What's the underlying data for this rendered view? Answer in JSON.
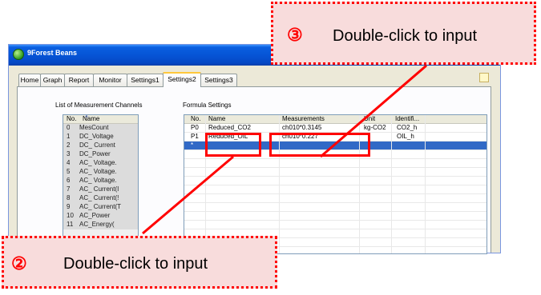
{
  "window": {
    "title": "9Forest Beans"
  },
  "tabs": [
    "Home",
    "Graph",
    "Report",
    "Monitor",
    "Settings1",
    "Settings2",
    "Settings3"
  ],
  "active_tab": "Settings2",
  "channels": {
    "label": "List of Measurement Channels",
    "headers": [
      "No.",
      "Name"
    ],
    "rows": [
      [
        "0",
        "MesCount"
      ],
      [
        "1",
        "DC_Voltage"
      ],
      [
        "2",
        "DC_ Current"
      ],
      [
        "3",
        "DC_Power"
      ],
      [
        "4",
        "AC_ Voltage."
      ],
      [
        "5",
        "AC_ Voltage."
      ],
      [
        "6",
        "AC_ Voltage."
      ],
      [
        "7",
        "AC_ Current(I"
      ],
      [
        "8",
        "AC_ Current(!"
      ],
      [
        "9",
        "AC_ Current(T"
      ],
      [
        "10",
        "AC_Power"
      ],
      [
        "11",
        "AC_Energy("
      ]
    ]
  },
  "formula": {
    "label": "Formula Settings",
    "headers": [
      "No.",
      "Name",
      "Measurements",
      "Unit",
      "Identifi..."
    ],
    "rows": [
      [
        "P0",
        "Reduced_CO2",
        "ch010*0.3145",
        "kg-CO2",
        "CO2_h"
      ],
      [
        "P1",
        "Reduced_OIL",
        "ch010*0.227",
        "",
        "OIL_h"
      ],
      [
        "*",
        "",
        "",
        "",
        ""
      ]
    ]
  },
  "annotations": {
    "step2": {
      "number": "②",
      "text": "Double-click to input"
    },
    "step3": {
      "number": "③",
      "text": "Double-click to input"
    }
  },
  "colors": {
    "highlight": "#ff0000",
    "callout_bg": "#f8dcdc",
    "selection": "#3169c6",
    "title_bar": "#0654d6"
  }
}
